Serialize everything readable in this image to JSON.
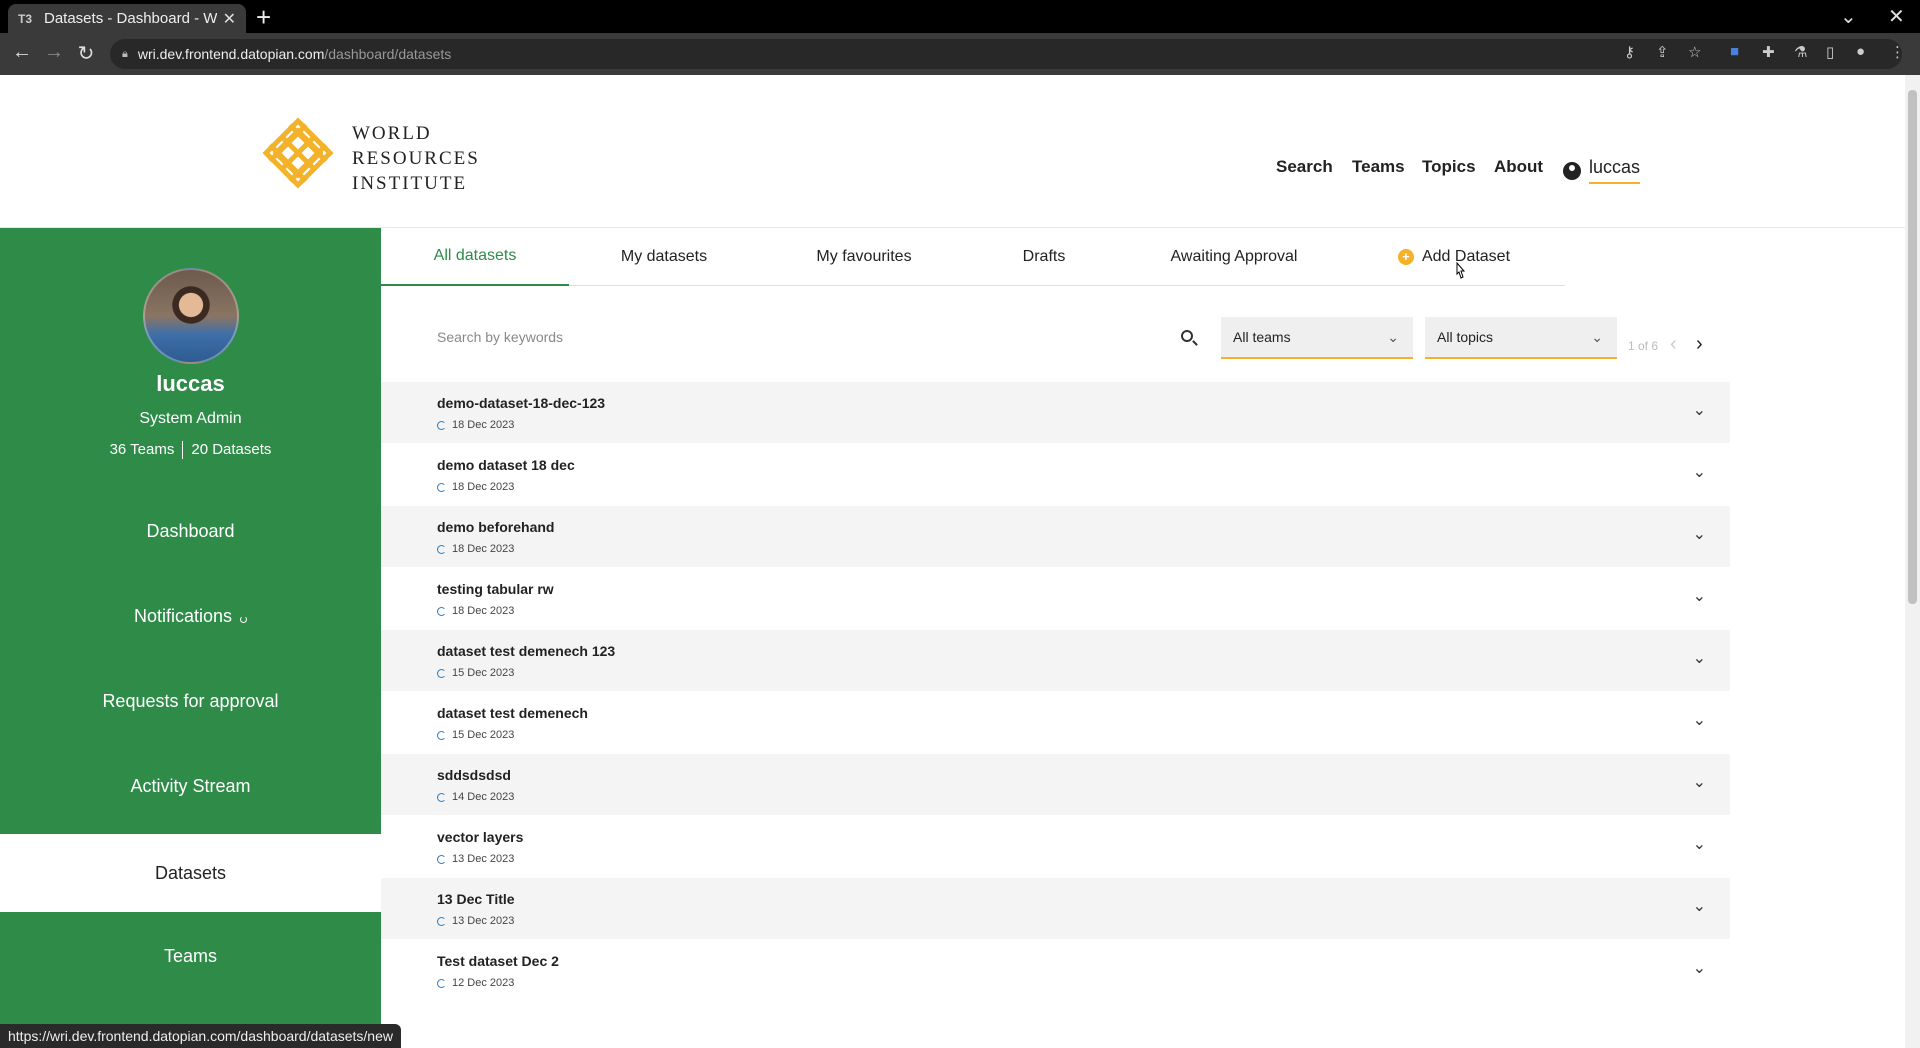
{
  "browser": {
    "tab_title": "Datasets - Dashboard - W",
    "tab_favicon": "T3",
    "url_host": "wri.dev.frontend.datopian.com",
    "url_path": "/dashboard/datasets",
    "status_url": "https://wri.dev.frontend.datopian.com/dashboard/datasets/new"
  },
  "header": {
    "logo_lines": [
      "WORLD",
      "RESOURCES",
      "INSTITUTE"
    ],
    "nav": [
      "Search",
      "Teams",
      "Topics",
      "About"
    ],
    "user": "luccas"
  },
  "sidebar": {
    "name": "luccas",
    "role": "System Admin",
    "teams_count": "36 Teams",
    "datasets_count": "20 Datasets",
    "items": [
      "Dashboard",
      "Notifications",
      "Requests for approval",
      "Activity Stream",
      "Datasets",
      "Teams"
    ]
  },
  "tabs": [
    "All datasets",
    "My datasets",
    "My favourites",
    "Drafts",
    "Awaiting Approval",
    "Add Dataset"
  ],
  "search": {
    "placeholder": "Search by keywords"
  },
  "filters": {
    "teams": "All teams",
    "topics": "All topics"
  },
  "pager": {
    "text": "1 of 6"
  },
  "datasets": [
    {
      "name": "demo-dataset-18-dec-123",
      "date": "18 Dec 2023"
    },
    {
      "name": "demo dataset 18 dec",
      "date": "18 Dec 2023"
    },
    {
      "name": "demo beforehand",
      "date": "18 Dec 2023"
    },
    {
      "name": "testing tabular rw",
      "date": "18 Dec 2023"
    },
    {
      "name": "dataset test demenech 123",
      "date": "15 Dec 2023"
    },
    {
      "name": "dataset test demenech",
      "date": "15 Dec 2023"
    },
    {
      "name": "sddsdsdsd",
      "date": "14 Dec 2023"
    },
    {
      "name": "vector layers",
      "date": "13 Dec 2023"
    },
    {
      "name": "13 Dec Title",
      "date": "13 Dec 2023"
    },
    {
      "name": "Test dataset Dec 2",
      "date": "12 Dec 2023"
    }
  ],
  "colors": {
    "green": "#2e8b48",
    "accent": "#f3b229"
  }
}
